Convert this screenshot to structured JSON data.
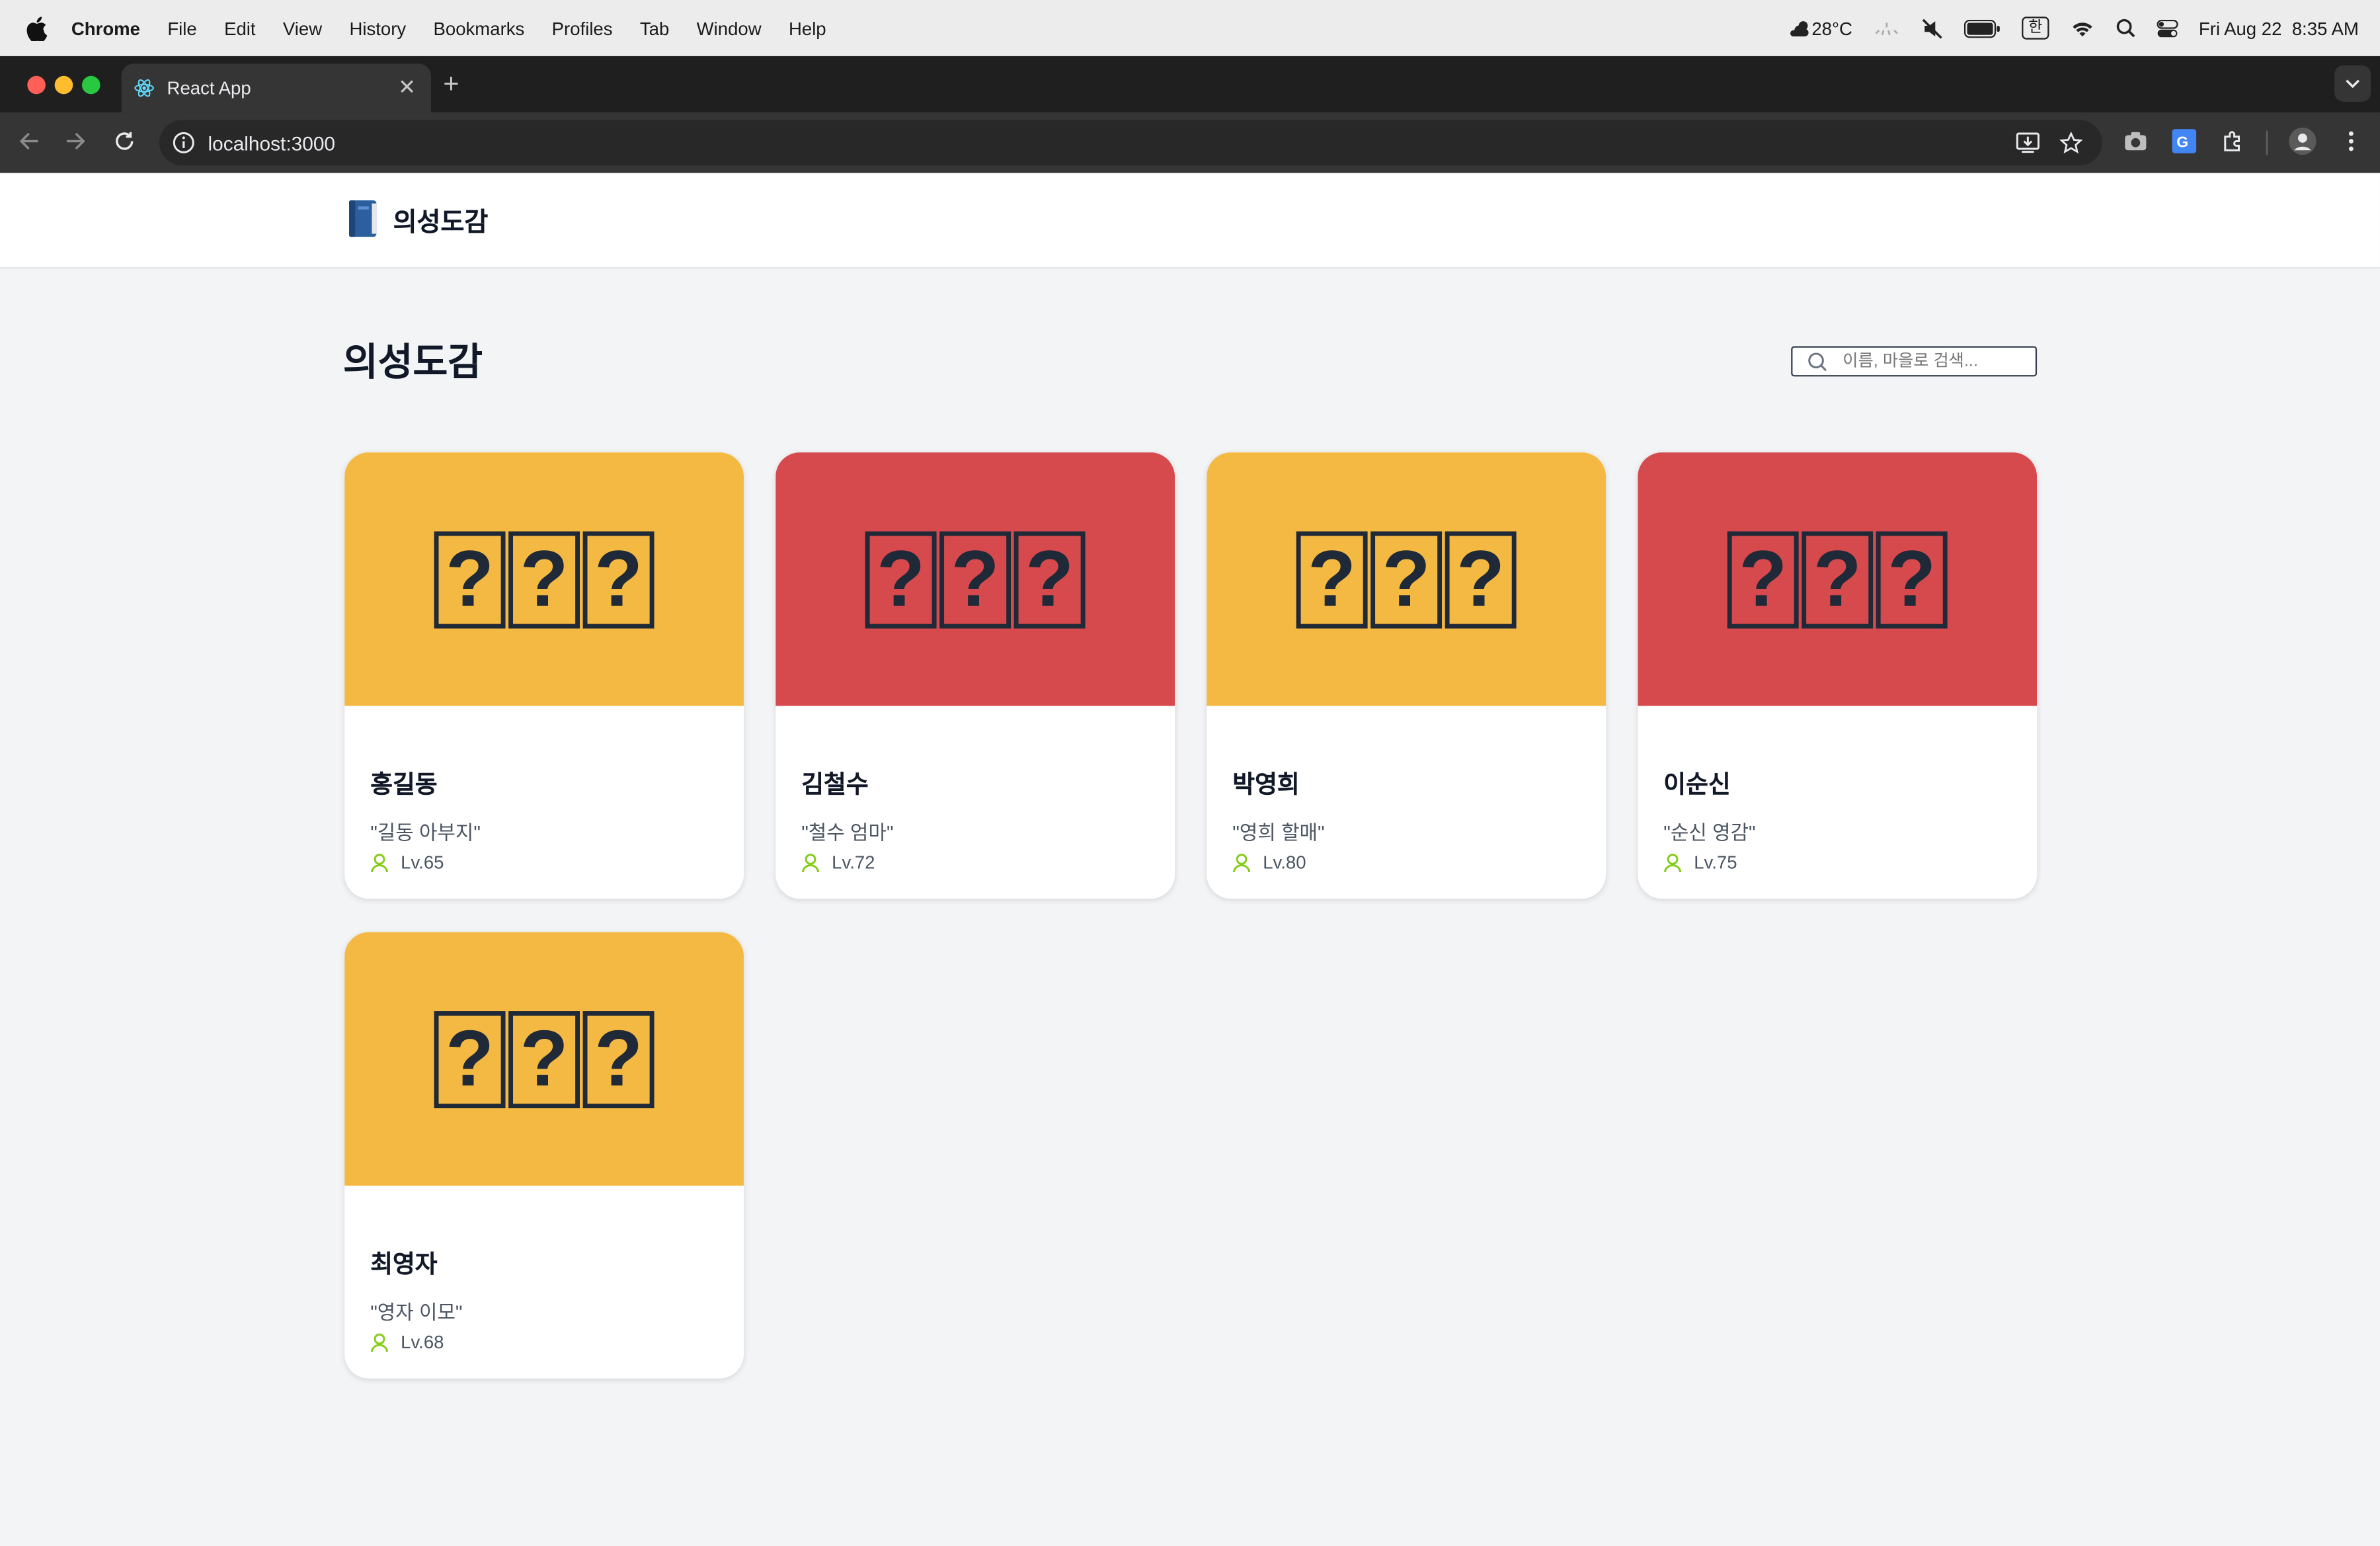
{
  "menubar": {
    "app": "Chrome",
    "items": [
      "File",
      "Edit",
      "View",
      "History",
      "Bookmarks",
      "Profiles",
      "Tab",
      "Window",
      "Help"
    ],
    "weather": "28°C",
    "input_source": "한",
    "datetime": "Fri Aug 22  8:35 AM"
  },
  "browser": {
    "tab_title": "React App",
    "url": "localhost:3000"
  },
  "header": {
    "brand": "의성도감"
  },
  "main": {
    "title": "의성도감",
    "search_placeholder": "이름, 마을로 검색..."
  },
  "cards": [
    {
      "name": "홍길동",
      "nickname": "\"길동 아부지\"",
      "level": "Lv.65",
      "color": "#f4b942",
      "mystery": [
        "?",
        "?",
        "?"
      ]
    },
    {
      "name": "김철수",
      "nickname": "\"철수 엄마\"",
      "level": "Lv.72",
      "color": "#d64a4d",
      "mystery": [
        "?",
        "?",
        "?"
      ]
    },
    {
      "name": "박영희",
      "nickname": "\"영희 할매\"",
      "level": "Lv.80",
      "color": "#f4b942",
      "mystery": [
        "?",
        "?",
        "?"
      ]
    },
    {
      "name": "이순신",
      "nickname": "\"순신 영감\"",
      "level": "Lv.75",
      "color": "#d64a4d",
      "mystery": [
        "?",
        "?",
        "?"
      ]
    },
    {
      "name": "최영자",
      "nickname": "\"영자 이모\"",
      "level": "Lv.68",
      "color": "#f4b942",
      "mystery": [
        "?",
        "?",
        "?"
      ]
    }
  ],
  "icons": {
    "person": "person-icon",
    "search": "search-icon",
    "book": "book-icon"
  }
}
